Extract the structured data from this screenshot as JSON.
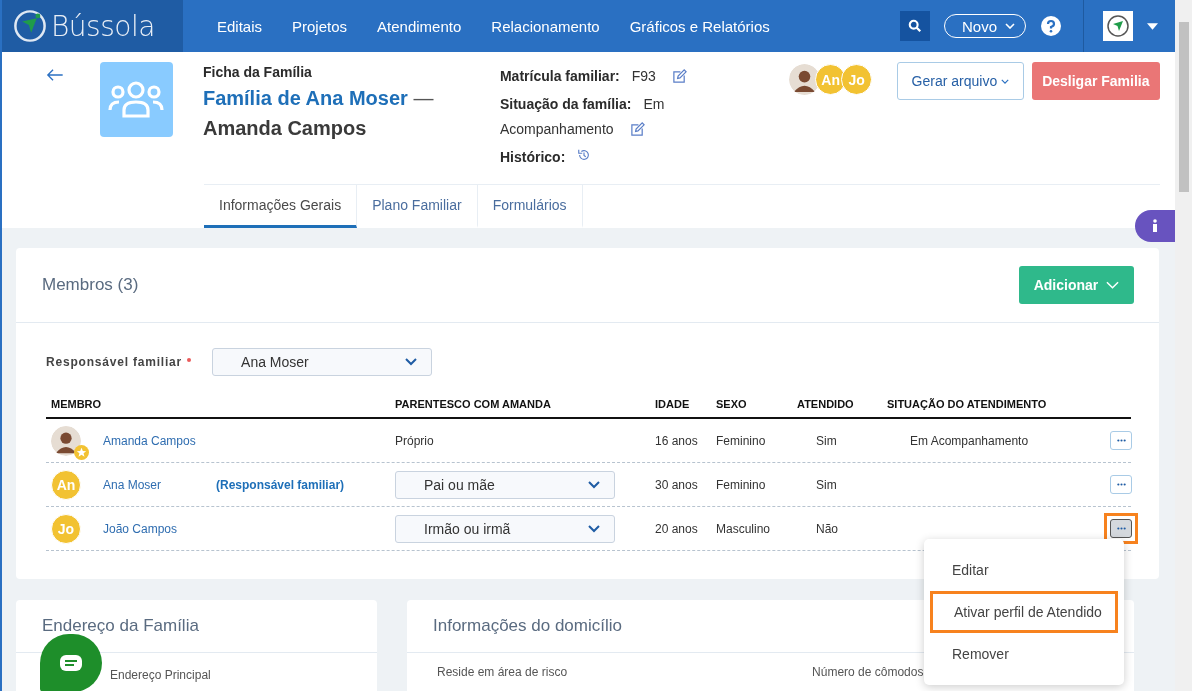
{
  "topbar": {
    "logo": "Bússola",
    "nav": [
      "Editais",
      "Projetos",
      "Atendimento",
      "Relacionamento",
      "Gráficos e Relatórios"
    ],
    "new_button": "Novo"
  },
  "header": {
    "subtitle": "Ficha da Família",
    "title_link": "Família de Ana Moser",
    "title_dash": "—",
    "title_rest": "Amanda Campos",
    "fields": [
      {
        "label": "Matrícula familiar:",
        "value": "F93",
        "kind": "edit"
      },
      {
        "label": "Situação da família:",
        "value": "Em",
        "value_cont": "Acompanhamento",
        "kind": "edit"
      },
      {
        "label": "Histórico:",
        "kind": "history"
      }
    ],
    "avatars": [
      {
        "kind": "photo"
      },
      {
        "kind": "initials",
        "text": "An"
      },
      {
        "kind": "initials",
        "text": "Jo"
      }
    ],
    "generate_button": "Gerar arquivo",
    "disconnect_button": "Desligar Familia"
  },
  "tabs": [
    {
      "label": "Informações Gerais",
      "selected": true
    },
    {
      "label": "Plano Familiar",
      "selected": false
    },
    {
      "label": "Formulários",
      "selected": false
    }
  ],
  "members_card": {
    "title": "Membros (3)",
    "add_button": "Adicionar",
    "responsible_label": "Responsável familiar",
    "responsible_value": "Ana Moser",
    "columns": [
      "MEMBRO",
      "PARENTESCO COM AMANDA",
      "IDADE",
      "SEXO",
      "ATENDIDO",
      "SITUAÇÃO DO ATENDIMENTO"
    ],
    "rows": [
      {
        "avatar": {
          "kind": "photo",
          "star": true
        },
        "name": "Amanda Campos",
        "relation": {
          "kind": "text",
          "value": "Próprio"
        },
        "age": "16 anos",
        "sex": "Feminino",
        "served": "Sim",
        "status": "Em Acompanhamento",
        "highlighted": false
      },
      {
        "avatar": {
          "kind": "initials",
          "text": "An",
          "star": false
        },
        "name": "Ana Moser",
        "tag": "(Responsável familiar)",
        "relation": {
          "kind": "select",
          "value": "Pai ou mãe"
        },
        "age": "30 anos",
        "sex": "Feminino",
        "served": "Sim",
        "highlighted": false
      },
      {
        "avatar": {
          "kind": "initials",
          "text": "Jo",
          "star": false
        },
        "name": "João Campos",
        "relation": {
          "kind": "select",
          "value": "Irmão ou irmã"
        },
        "age": "20 anos",
        "sex": "Masculino",
        "served": "Não",
        "highlighted": true
      }
    ]
  },
  "row_menu": [
    {
      "label": "Editar",
      "highlighted": false
    },
    {
      "label": "Ativar perfil de Atendido",
      "highlighted": true
    },
    {
      "label": "Remover",
      "highlighted": false
    }
  ],
  "address_card": {
    "title": "Endereço da Família",
    "field": "Endereço Principal"
  },
  "household_card": {
    "title": "Informações do domicílio",
    "fields": [
      "Reside em área de risco",
      "Número de cômodos"
    ]
  }
}
